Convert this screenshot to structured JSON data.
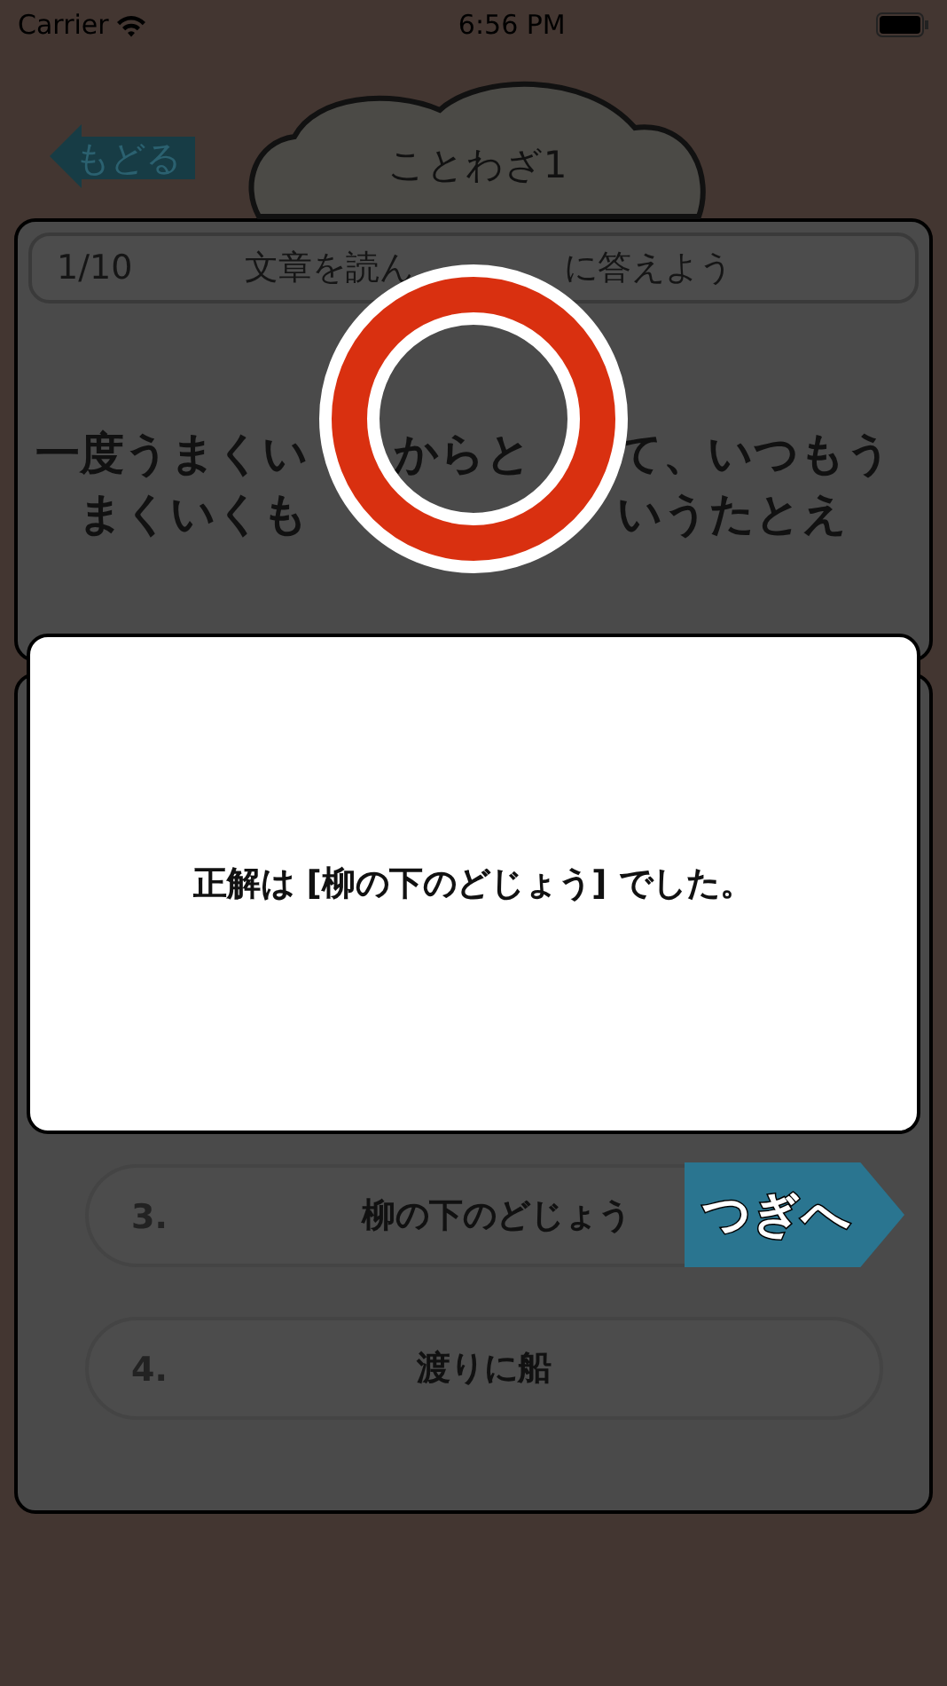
{
  "status_bar": {
    "carrier": "Carrier",
    "time": "6:56 PM"
  },
  "back_button": {
    "label": "もどる"
  },
  "title": "ことわざ1",
  "question_header": {
    "counter": "1/10",
    "instruction_left": "文章を読ん",
    "instruction_right": "に答えよう"
  },
  "question_lines": [
    {
      "left": "一度うまくい",
      "middle": "からと",
      "right": "て、いつもう"
    },
    {
      "left": "まくいくも",
      "right": "いうたとえ"
    }
  ],
  "result_mark": {
    "kind": "correct"
  },
  "result_dialog": {
    "message": "正解は [柳の下のどじょう] でした。"
  },
  "options": [
    {
      "number": "3.",
      "text": "柳の下のどじょう"
    },
    {
      "number": "4.",
      "text": "渡りに船"
    }
  ],
  "next_button": {
    "label": "つぎへ"
  }
}
